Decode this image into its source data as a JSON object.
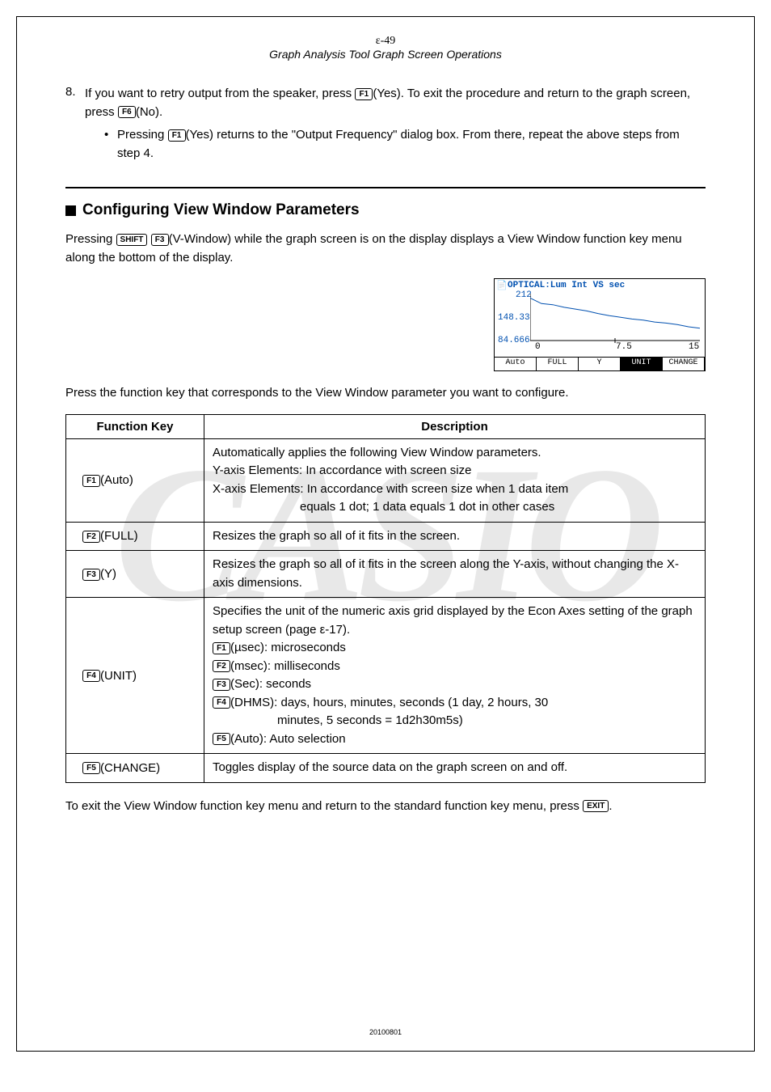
{
  "header": {
    "page_number": "ε-49",
    "title": "Graph Analysis Tool Graph Screen Operations"
  },
  "watermark": "CASIO",
  "step8": {
    "number": "8.",
    "text_before_f1": "If you want to retry output from the speaker, press ",
    "f1_label": "F1",
    "text_after_f1": "(Yes). To exit the procedure and return to the graph screen, press ",
    "f6_label": "F6",
    "text_after_f6": "(No).",
    "bullet_before": "Pressing ",
    "bullet_f1": "F1",
    "bullet_after": "(Yes) returns to the \"Output Frequency\" dialog box. From there, repeat the above steps from step 4."
  },
  "section": {
    "heading": "Configuring View Window Parameters",
    "intro_before": "Pressing ",
    "shift_key": "SHIFT",
    "f3_key": "F3",
    "intro_after": "(V-Window) while the graph screen is on the display displays a View Window function key menu along the bottom of the display.",
    "pre_table": "Press the function key that corresponds to the View Window parameter you want to configure."
  },
  "screenshot": {
    "title": "OPTICAL:Lum Int VS sec",
    "y_top": "212",
    "y_mid": "148.33",
    "y_bot": "84.666",
    "x0": "0",
    "x_mid": "7.5",
    "x_end": "15",
    "menu": [
      "Auto",
      "FULL",
      "Y",
      "UNIT",
      "CHANGE"
    ]
  },
  "chart_data": {
    "type": "line",
    "title": "OPTICAL:Lum Int VS sec",
    "xlabel": "sec",
    "ylabel": "Lum Int",
    "xlim": [
      0,
      15
    ],
    "ylim": [
      84.666,
      212
    ],
    "x": [
      0,
      1,
      2,
      3,
      4,
      5,
      6,
      7,
      8,
      9,
      10,
      11,
      12,
      13,
      14,
      15
    ],
    "y": [
      200,
      185,
      182,
      175,
      170,
      165,
      158,
      152,
      148,
      143,
      140,
      135,
      132,
      128,
      122,
      118
    ]
  },
  "table": {
    "headers": [
      "Function Key",
      "Description"
    ],
    "rows": [
      {
        "key": "F1",
        "key_label": "(Auto)",
        "desc_l1": "Automatically applies the following View Window parameters.",
        "desc_l2": "Y-axis Elements: In accordance with screen size",
        "desc_l3": "X-axis Elements: In accordance with screen size when 1 data item",
        "desc_l4": "equals 1 dot; 1 data equals 1 dot in other cases"
      },
      {
        "key": "F2",
        "key_label": "(FULL)",
        "desc": "Resizes the graph so all of it fits in the screen."
      },
      {
        "key": "F3",
        "key_label": "(Y)",
        "desc": "Resizes the graph so all of it fits in the screen along the Y-axis, without changing the X-axis dimensions."
      },
      {
        "key": "F4",
        "key_label": "(UNIT)",
        "desc_intro": "Specifies the unit of the numeric axis grid displayed by the Econ Axes setting of the graph setup screen (page ε-17).",
        "sub1_key": "F1",
        "sub1_txt": "(µsec): microseconds",
        "sub2_key": "F2",
        "sub2_txt": "(msec): milliseconds",
        "sub3_key": "F3",
        "sub3_txt": "(Sec): seconds",
        "sub4_key": "F4",
        "sub4_txt": "(DHMS): days, hours, minutes, seconds (1 day, 2 hours, 30",
        "sub4_cont": "minutes, 5 seconds = 1d2h30m5s)",
        "sub5_key": "F5",
        "sub5_txt": "(Auto): Auto selection"
      },
      {
        "key": "F5",
        "key_label": "(CHANGE)",
        "desc": "Toggles display of the source data on the graph screen on and off."
      }
    ]
  },
  "footer_text_before": "To exit the View Window function key menu and return to the standard function key menu, press ",
  "exit_key": "EXIT",
  "footer_text_after": ".",
  "footer_code": "20100801"
}
